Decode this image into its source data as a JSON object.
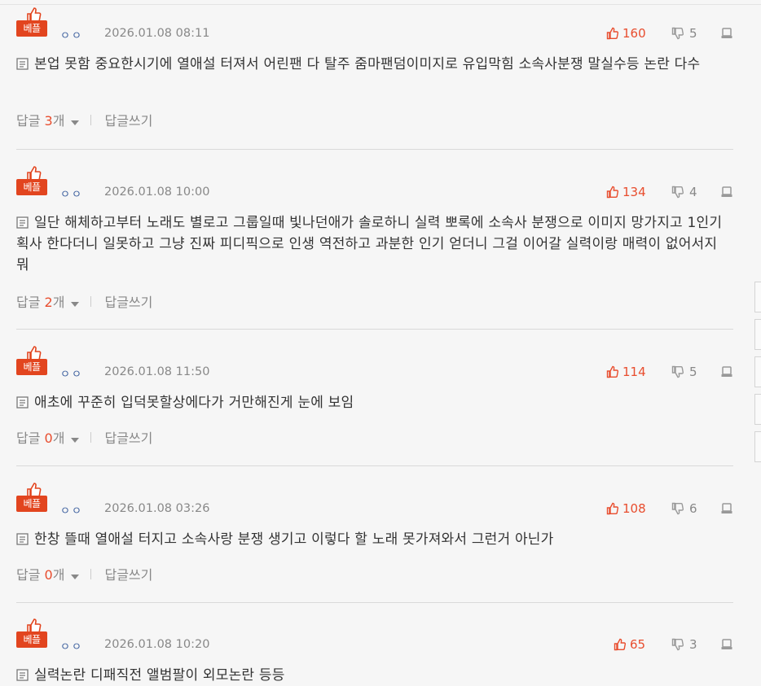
{
  "badge_label": "베플",
  "reply_label": "답글",
  "reply_unit": "개",
  "write_reply_label": "답글쓰기",
  "colors": {
    "accent": "#e2451f",
    "recommend": "#e84d2e",
    "muted": "#888888"
  },
  "comments": [
    {
      "nick": "ㅇㅇ",
      "date": "2026.01.08 08:11",
      "up": "160",
      "down": "5",
      "text": "본업 못함 중요한시기에 열애설 터져서 어린팬 다 탈주 줌마팬덤이미지로 유입막힘 소속사분쟁 말실수등 논란 다수",
      "replies": "3"
    },
    {
      "nick": "ㅇㅇ",
      "date": "2026.01.08 10:00",
      "up": "134",
      "down": "4",
      "text": "일단 해체하고부터 노래도 별로고 그룹일때 빛나던애가 솔로하니 실력 뽀록에 소속사 분쟁으로 이미지 망가지고 1인기획사 한다더니 일못하고 그냥 진짜 피디픽으로 인생 역전하고 과분한 인기 얻더니 그걸 이어갈 실력이랑 매력이 없어서지 뭐",
      "replies": "2"
    },
    {
      "nick": "ㅇㅇ",
      "date": "2026.01.08 11:50",
      "up": "114",
      "down": "5",
      "text": "애초에 꾸준히 입덕못할상에다가 거만해진게 눈에 보임",
      "replies": "0"
    },
    {
      "nick": "ㅇㅇ",
      "date": "2026.01.08 03:26",
      "up": "108",
      "down": "6",
      "text": "한창 뜰때 열애설 터지고 소속사랑 분쟁 생기고 이렇다 할 노래 못가져와서 그런거 아닌가",
      "replies": "0"
    },
    {
      "nick": "ㅇㅇ",
      "date": "2026.01.08 10:20",
      "up": "65",
      "down": "3",
      "text": "실력논란 디패직전 앨범팔이 외모논란 등등",
      "replies": ""
    }
  ],
  "icons": {
    "badge": "thumbs-up-icon",
    "up": "thumbs-up-icon",
    "down": "thumbs-down-icon",
    "report": "report-icon",
    "memo": "memo-icon",
    "dropdown": "caret-down-icon"
  }
}
